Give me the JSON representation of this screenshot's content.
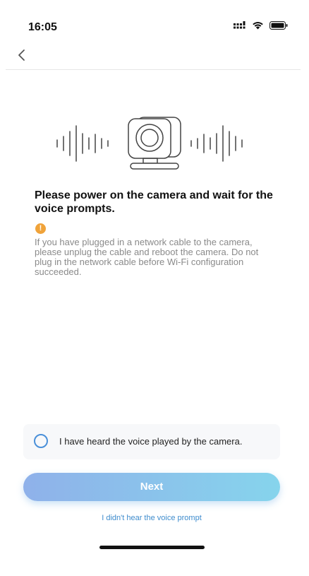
{
  "status_bar": {
    "time": "16:05",
    "icons": [
      "signal-icon",
      "wifi-icon",
      "battery-icon"
    ]
  },
  "nav": {
    "back_icon": "chevron-left-icon"
  },
  "illustration": {
    "icon": "camera-sound-wave-illustration"
  },
  "main": {
    "title": "Please power on the camera and wait for the voice prompts.",
    "warning_icon": "!",
    "warning_text": "If you have plugged in a network cable to the camera, please unplug the cable and reboot the camera. Do not plug in the network cable before Wi-Fi configuration succeeded."
  },
  "confirm": {
    "label": "I have heard the voice played by the camera.",
    "checked": false
  },
  "next_button": {
    "label": "Next"
  },
  "help_link": {
    "label": "I didn't hear the voice prompt"
  },
  "colors": {
    "accent": "#4a90d9",
    "warning": "#f0a33a",
    "link": "#3e8ccd",
    "button_gradient_start": "#8fb1ea",
    "button_gradient_end": "#86d4ec"
  }
}
